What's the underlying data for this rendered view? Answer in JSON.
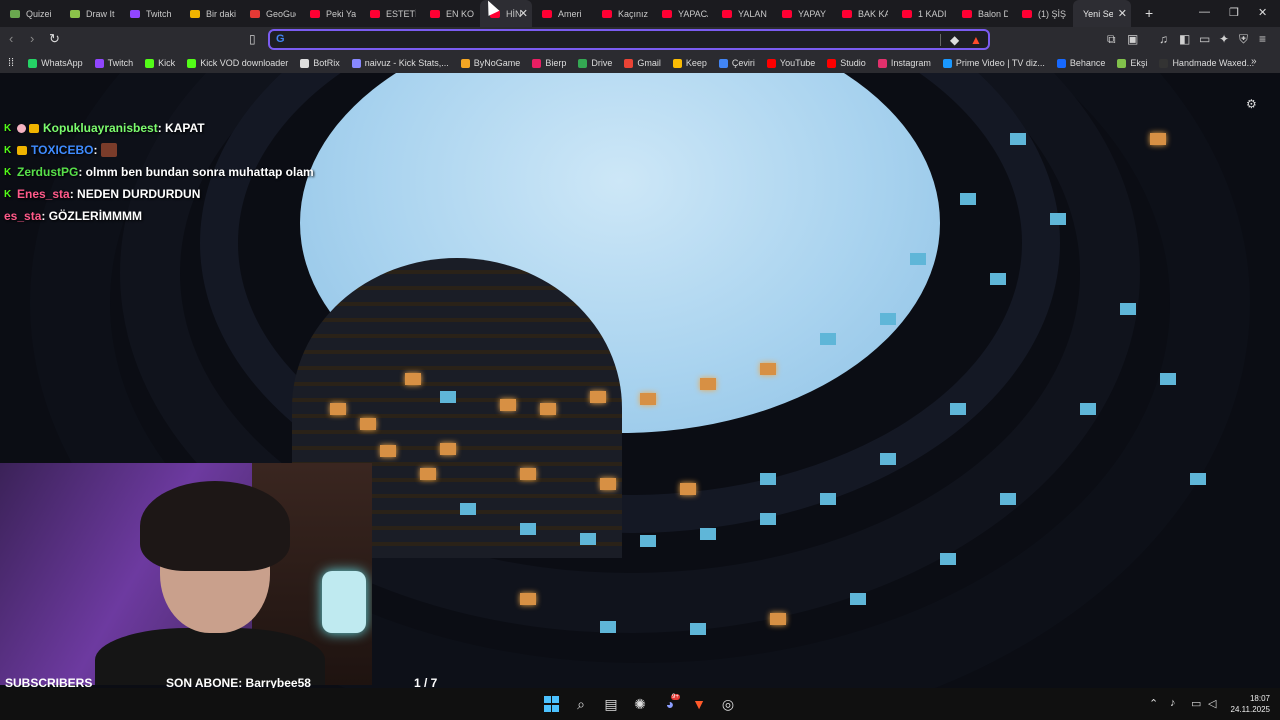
{
  "tabs": [
    {
      "title": "Quizei",
      "color": "#6aa84f"
    },
    {
      "title": "Draw It",
      "color": "#8bc34a"
    },
    {
      "title": "Twitch",
      "color": "#9146ff"
    },
    {
      "title": "Bir daki",
      "color": "#f0b400"
    },
    {
      "title": "GeoGue",
      "color": "#e53935"
    },
    {
      "title": "Peki Ya",
      "color": "#ff0033"
    },
    {
      "title": "ESTETİ",
      "color": "#ff0033"
    },
    {
      "title": "EN KO",
      "color": "#ff0033"
    },
    {
      "title": "HİN",
      "color": "#ff0033",
      "active": true
    },
    {
      "title": "Ameri",
      "color": "#ff0033"
    },
    {
      "title": "Kaçınız",
      "color": "#ff0033"
    },
    {
      "title": "YAPACA",
      "color": "#ff0033"
    },
    {
      "title": "YALAN",
      "color": "#ff0033"
    },
    {
      "title": "YAPAY",
      "color": "#ff0033"
    },
    {
      "title": "BAK KA",
      "color": "#ff0033"
    },
    {
      "title": "1 KADI",
      "color": "#ff0033"
    },
    {
      "title": "Balon D",
      "color": "#ff0033"
    },
    {
      "title": "(1) ŞİŞ",
      "color": "#ff0033"
    }
  ],
  "current_tab": {
    "title": "Yeni Sek"
  },
  "omnibox": {
    "value": "",
    "placeholder": ""
  },
  "bookmarks": [
    {
      "label": "WhatsApp",
      "color": "#25d366"
    },
    {
      "label": "Twitch",
      "color": "#9146ff"
    },
    {
      "label": "Kick",
      "color": "#53fc18"
    },
    {
      "label": "Kick VOD downloader",
      "color": "#53fc18"
    },
    {
      "label": "BotRix",
      "color": "#dddddd"
    },
    {
      "label": "naivuz - Kick Stats,...",
      "color": "#8888ff"
    },
    {
      "label": "ByNoGame",
      "color": "#f5a623"
    },
    {
      "label": "Bierp",
      "color": "#e91e63"
    },
    {
      "label": "Drive",
      "color": "#34a853"
    },
    {
      "label": "Gmail",
      "color": "#ea4335"
    },
    {
      "label": "Keep",
      "color": "#fbbc04"
    },
    {
      "label": "Çeviri",
      "color": "#4285f4"
    },
    {
      "label": "YouTube",
      "color": "#ff0000"
    },
    {
      "label": "Studio",
      "color": "#ff0000"
    },
    {
      "label": "Instagram",
      "color": "#e1306c"
    },
    {
      "label": "Prime Video | TV diz...",
      "color": "#1a98ff"
    },
    {
      "label": "Behance",
      "color": "#1769ff"
    },
    {
      "label": "Ekşi",
      "color": "#81c14b"
    },
    {
      "label": "Handmade Waxed...",
      "color": "#333333"
    }
  ],
  "chat": [
    {
      "user": "Kopukluayranisbest",
      "text": ": KAPAT",
      "user_color": "#7cfc6e"
    },
    {
      "user": "TOXICEBO",
      "text": " :",
      "user_color": "#3f8cff"
    },
    {
      "user": "ZerdustPG",
      "text": ": olmm ben bundan sonra muhattap olam",
      "user_color": "#58e04a"
    },
    {
      "user": "Enes_sta",
      "text": ": NEDEN DURDURDUN",
      "user_color": "#ff5a8a"
    },
    {
      "user": "es_sta",
      "text": ": GÖZLERİMMMM",
      "user_color": "#ff5a8a"
    }
  ],
  "stream_overlay": {
    "subscribers_label": "SUBSCRIBERS",
    "last_sub": "SON ABONE: Barrybee58",
    "page_indicator": "1 / 7",
    "progress_fraction": 0.14
  },
  "taskbar": {
    "time": "18:07",
    "date": "24.11.2025",
    "discord_badge": "9+"
  }
}
